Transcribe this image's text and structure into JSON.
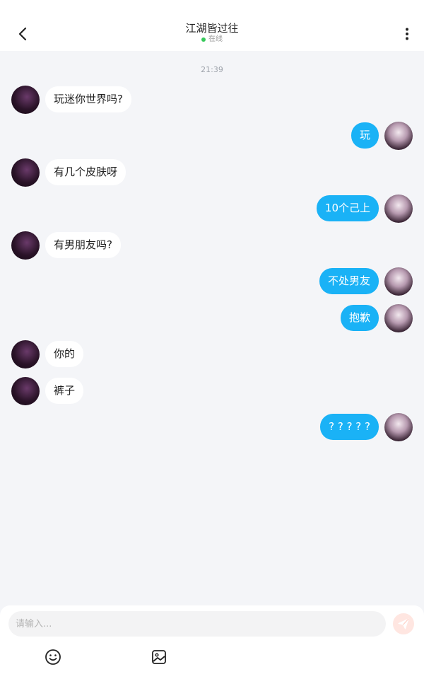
{
  "header": {
    "back_icon": "chevron-left-icon",
    "title": "江湖皆过往",
    "status_text": "在线",
    "status_color": "#37c95b",
    "more_icon": "more-vertical-icon"
  },
  "chat": {
    "timestamp": "21:39",
    "messages": [
      {
        "side": "left",
        "text": "玩迷你世界吗?"
      },
      {
        "side": "right",
        "text": "玩"
      },
      {
        "side": "left",
        "text": "有几个皮肤呀"
      },
      {
        "side": "right",
        "text": "10个己上"
      },
      {
        "side": "left",
        "text": "有男朋友吗?"
      },
      {
        "side": "right",
        "text": "不处男友"
      },
      {
        "side": "right",
        "text": "抱歉"
      },
      {
        "side": "left",
        "text": "你的"
      },
      {
        "side": "left",
        "text": "裤子"
      },
      {
        "side": "right",
        "text": "? ? ? ? ?"
      }
    ]
  },
  "composer": {
    "placeholder": "请输入...",
    "value": "",
    "send_icon": "send-icon",
    "emoji_icon": "emoji-icon",
    "image_icon": "image-icon"
  },
  "colors": {
    "accent": "#1ab2f6",
    "background": "#f4f5f8",
    "bubble_incoming": "#ffffff",
    "send_button": "#ffe6e1"
  }
}
